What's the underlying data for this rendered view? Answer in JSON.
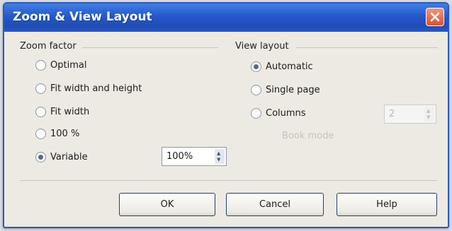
{
  "dialog": {
    "title": "Zoom & View Layout"
  },
  "zoom_factor": {
    "label": "Zoom factor",
    "options": [
      "Optimal",
      "Fit width and height",
      "Fit width",
      "100 %",
      "Variable"
    ],
    "selected": "Variable",
    "variable_value": "100%"
  },
  "view_layout": {
    "label": "View layout",
    "options": [
      "Automatic",
      "Single page",
      "Columns"
    ],
    "selected": "Automatic",
    "columns_value": "2",
    "book_mode_label": "Book mode"
  },
  "buttons": {
    "ok": "OK",
    "cancel": "Cancel",
    "help": "Help"
  }
}
